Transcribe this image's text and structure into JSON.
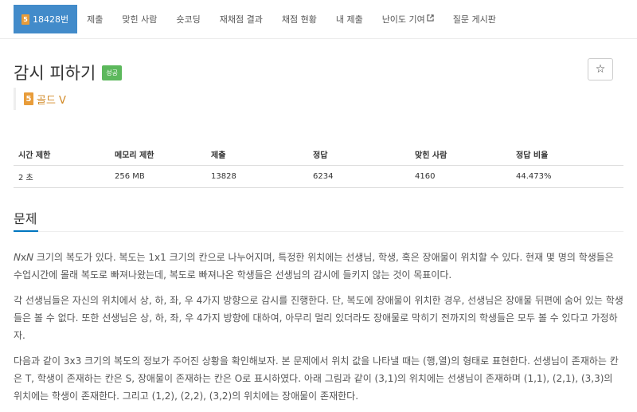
{
  "nav": {
    "problem_id": "18428번",
    "tier_digit": "5",
    "items": [
      "제출",
      "맞힌 사람",
      "숏코딩",
      "재채점 결과",
      "채점 현황",
      "내 제출",
      "난이도 기여",
      "질문 게시판"
    ]
  },
  "problem": {
    "title": "감시 피하기",
    "status": "성공",
    "tier_digit": "5",
    "tier": "골드 V"
  },
  "info_table": {
    "headers": [
      "시간 제한",
      "메모리 제한",
      "제출",
      "정답",
      "맞힌 사람",
      "정답 비율"
    ],
    "values": [
      "2 초",
      "256 MB",
      "13828",
      "6234",
      "4160",
      "44.473%"
    ]
  },
  "section": {
    "title": "문제"
  },
  "description": {
    "p1_var": "N",
    "p1_x": "x",
    "p1_rest": " 크기의 복도가 있다. 복도는 1x1 크기의 칸으로 나누어지며, 특정한 위치에는 선생님, 학생, 혹은 장애물이 위치할 수 있다. 현재 몇 명의 학생들은 수업시간에 몰래 복도로 빠져나왔는데, 복도로 빠져나온 학생들은 선생님의 감시에 들키지 않는 것이 목표이다.",
    "p2": "각 선생님들은 자신의 위치에서 상, 하, 좌, 우 4가지 방향으로 감시를 진행한다. 단, 복도에 장애물이 위치한 경우, 선생님은 장애물 뒤편에 숨어 있는 학생들은 볼 수 없다. 또한 선생님은 상, 하, 좌, 우 4가지 방향에 대하여, 아무리 멀리 있더라도 장애물로 막히기 전까지의 학생들은 모두 볼 수 있다고 가정하자.",
    "p3": "다음과 같이 3x3 크기의 복도의 정보가 주어진 상황을 확인해보자. 본 문제에서 위치 값을 나타낼 때는 (행,열)의 형태로 표현한다. 선생님이 존재하는 칸은 T, 학생이 존재하는 칸은 S, 장애물이 존재하는 칸은 O로 표시하였다. 아래 그림과 같이 (3,1)의 위치에는 선생님이 존재하며 (1,1), (2,1), (3,3)의 위치에는 학생이 존재한다. 그리고 (1,2), (2,2), (3,2)의 위치에는 장애물이 존재한다."
  },
  "colors": {
    "active_tab": "#428bca",
    "tier_gold": "#d28a27",
    "success": "#5cb85c",
    "accent_underline": "#0076c0"
  }
}
